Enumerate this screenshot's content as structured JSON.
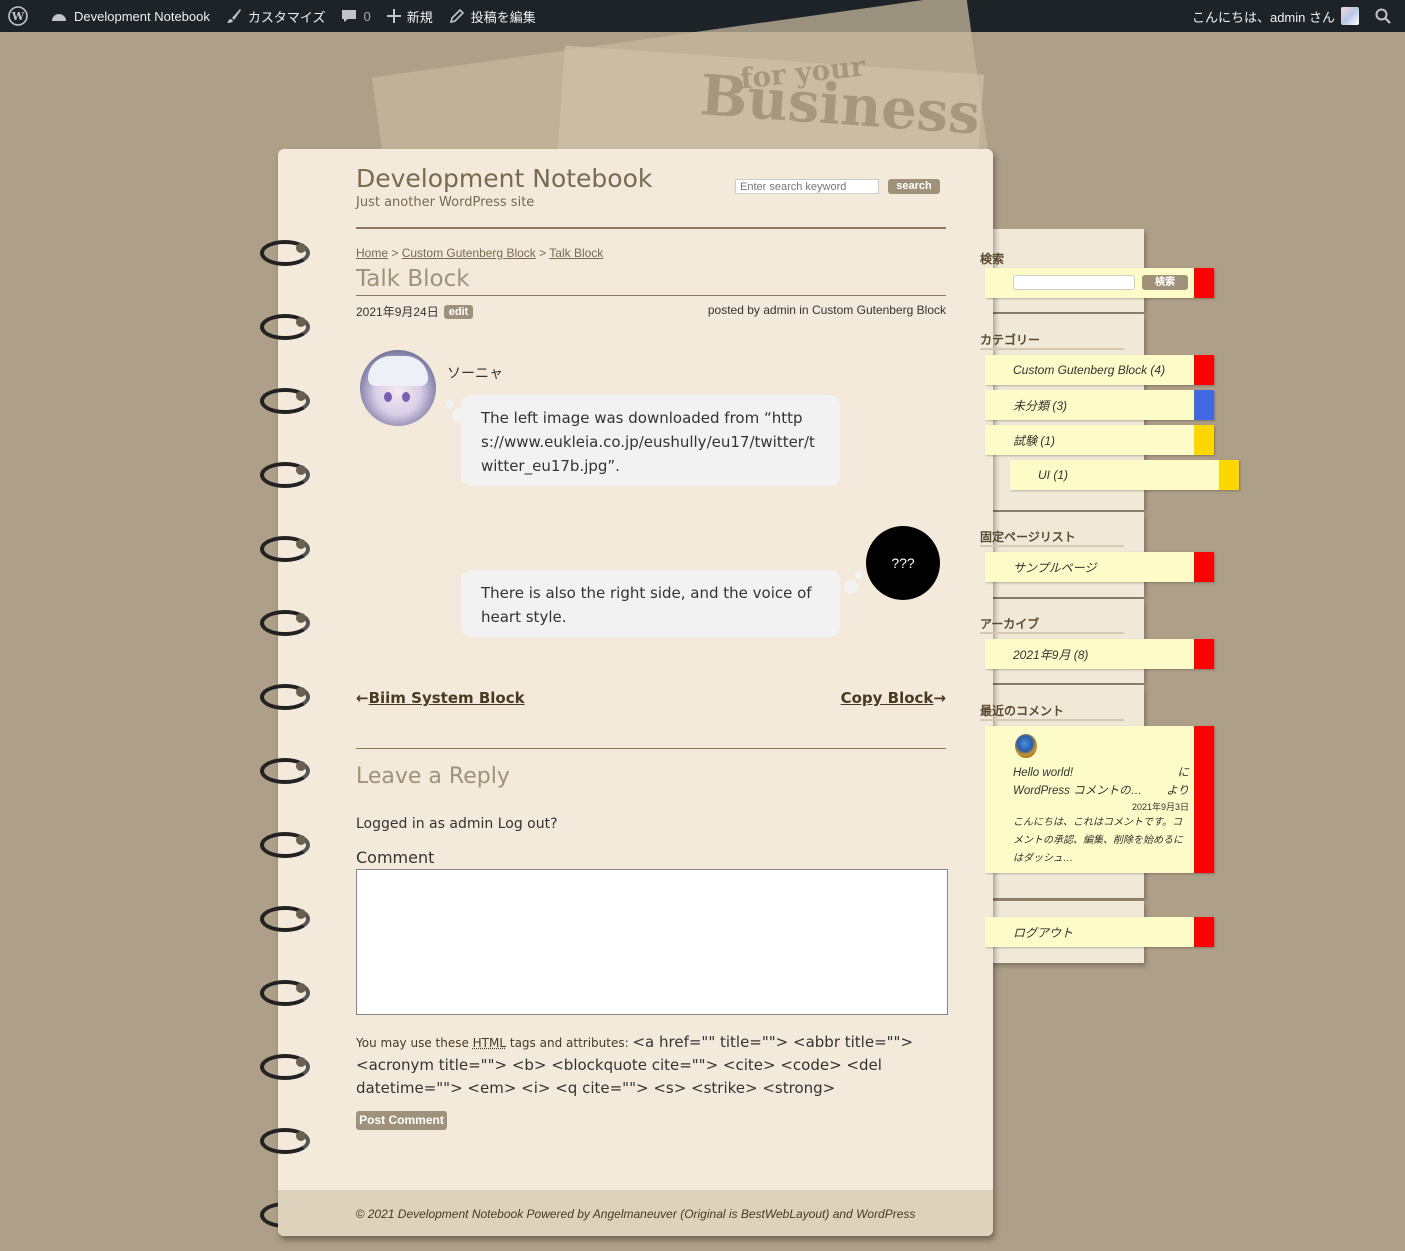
{
  "adminbar": {
    "site_name": "Development Notebook",
    "customize": "カスタマイズ",
    "comments_count": "0",
    "new": "新規",
    "edit_post": "投稿を編集",
    "greeting": "こんにちは、admin さん"
  },
  "site": {
    "title": "Development Notebook",
    "description": "Just another WordPress site"
  },
  "search": {
    "placeholder": "Enter search keyword",
    "button": "search"
  },
  "breadcrumb": {
    "home": "Home",
    "sep1": ">",
    "category": "Custom Gutenberg Block",
    "sep2": ">",
    "current": "Talk Block"
  },
  "post": {
    "title": "Talk Block",
    "date": "2021年9月24日",
    "edit": "edit",
    "meta_prefix": "posted by ",
    "author": "admin",
    "meta_in": " in ",
    "category": "Custom Gutenberg Block"
  },
  "talk": {
    "left_name": "ソーニャ",
    "left_text": "The left image was downloaded from “https://www.eukleia.co.jp/eushully/eu17/twitter/twitter_eu17b.jpg”.",
    "right_avatar": "???",
    "right_text": "There is also the right side, and the voice of heart style."
  },
  "nav": {
    "prev": "Biim System Block",
    "prev_arrow": "←",
    "next": "Copy Block",
    "next_arrow": "→"
  },
  "reply": {
    "title": "Leave a Reply",
    "logged_in": "Logged in as admin Log out?",
    "comment_label": "Comment",
    "allowed_prefix": "You may use these ",
    "allowed_html": "HTML",
    "allowed_mid": " tags and attributes: ",
    "allowed_tags": "<a href=\"\" title=\"\"> <abbr title=\"\"> <acronym title=\"\"> <b> <blockquote cite=\"\"> <cite> <code> <del datetime=\"\"> <em> <i> <q cite=\"\"> <s> <strike> <strong>",
    "submit": "Post Comment"
  },
  "footer": {
    "text1": "© 2021 Development Notebook Powered by ",
    "angel": "Angelmaneuver",
    "text2": " (Original is ",
    "bwl": "BestWebLayout",
    "text3": ") and ",
    "wp": "WordPress"
  },
  "sidebar": {
    "search_heading": "検索",
    "search_button": "検索",
    "categories_heading": "カテゴリー",
    "categories": [
      {
        "label": "Custom Gutenberg Block (4)",
        "color": "#ff0000"
      },
      {
        "label": "未分類 (3)",
        "color": "#4169e1"
      },
      {
        "label": "試験 (1)",
        "color": "#ffd700"
      },
      {
        "label": "UI (1)",
        "color": "#ffd700"
      }
    ],
    "pages_heading": "固定ページリスト",
    "pages": [
      {
        "label": "サンプルページ",
        "color": "#ff0000"
      }
    ],
    "archive_heading": "アーカイブ",
    "archives": [
      {
        "label": "2021年9月 (8)",
        "color": "#ff0000"
      }
    ],
    "recent_heading": "最近のコメント",
    "recent": {
      "post": "Hello world!",
      "ni": "に",
      "author": "WordPress コメントの…",
      "yori": "より",
      "date": "2021年9月3日",
      "excerpt": "こんにちは、これはコメントです。コメントの承認、編集、削除を始めるにはダッシュ…"
    },
    "logout": "ログアウト",
    "accent": "#ff0000"
  }
}
